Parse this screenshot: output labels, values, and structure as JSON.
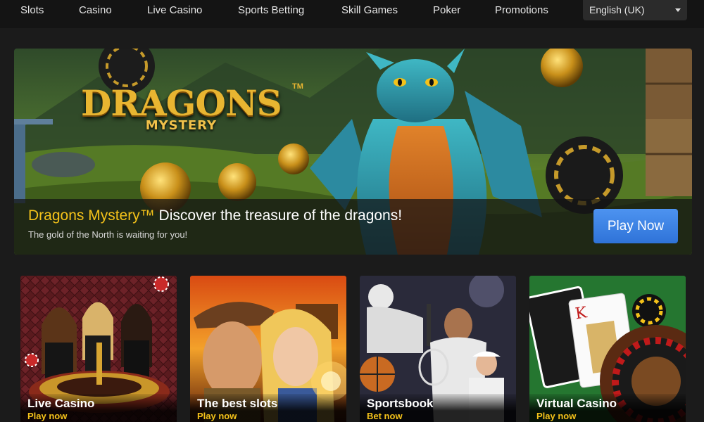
{
  "nav": {
    "items": [
      {
        "label": "Slots"
      },
      {
        "label": "Casino"
      },
      {
        "label": "Live Casino"
      },
      {
        "label": "Sports Betting"
      },
      {
        "label": "Skill Games"
      },
      {
        "label": "Poker"
      },
      {
        "label": "Promotions"
      }
    ],
    "language": "English (UK)"
  },
  "hero": {
    "logo_main": "DRAGONS",
    "logo_sub": "MYSTERY",
    "logo_tm": "TM",
    "title_brand": "Dragons Mystery™",
    "title_rest": " Discover the treasure of the dragons!",
    "subtitle": "The gold of the North is waiting for you!",
    "cta": "Play Now"
  },
  "cards": [
    {
      "title": "Live Casino",
      "cta": "Play now"
    },
    {
      "title": "The best slots",
      "cta": "Play now"
    },
    {
      "title": "Sportsbook",
      "cta": "Bet now"
    },
    {
      "title": "Virtual Casino",
      "cta": "Play now"
    }
  ],
  "colors": {
    "accent_gold": "#f4c21a",
    "button_blue": "#2f73d8",
    "background": "#1b1b1b"
  }
}
